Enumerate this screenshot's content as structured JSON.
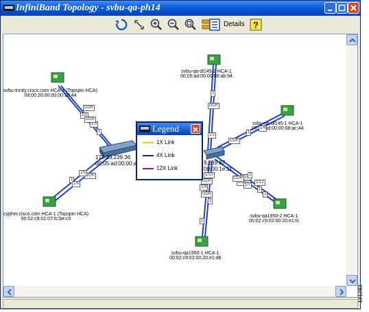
{
  "window": {
    "title": "InfiniBand Topology - svbu-qa-ph14"
  },
  "toolbar": {
    "details_label": "Details"
  },
  "nodes": {
    "dl145_2": {
      "name": "svbu-qa-dl145-2 HCA-1",
      "guid": "00:05:ad:00:00:08:ab:94"
    },
    "trinity": {
      "name": "svbu-trinity.cisco.com HCA-1 (Topspin HCA)",
      "guid": "08:00:20:00:00:00:10:44"
    },
    "dl145_1": {
      "name": "svbu-qa-dl145-1 HCA-1",
      "guid": "00:05:ad:00:00:08:ac:44"
    },
    "cypher": {
      "name": "cypher.cisco.com HCA-1 (Topspin HCA)",
      "guid": "00:02:c9:01:07:fc:be:c0"
    },
    "qa1950_2": {
      "name": "svbu-qa1950-2 HCA-1",
      "guid": "00:02:c9:02:00:20:e1:fc"
    },
    "qa1950_1": {
      "name": "svbu-qa1950-1 HCA-1",
      "guid": "00:02:c9:02:00:20:e1:d8"
    }
  },
  "switches": {
    "left": {
      "ip": "172.29.239.36",
      "guid": "00:05:ad:00:00:ab:4"
    },
    "right": {
      "ip": "9.239.67",
      "guid": "00:00:1e:11"
    }
  },
  "ports": {
    "p1": "1",
    "p2": "DDR",
    "p3": "1/1",
    "p4": "DDR",
    "p5": "1/2",
    "p6": "1/3",
    "p7": "DDR",
    "p8": "1",
    "p9": "1",
    "p10": "1/4",
    "p11": "DDR",
    "p12": "DDR",
    "p13": "1/5",
    "p14": "1",
    "p15": "1/6",
    "p16": "DDR",
    "p17": "1/10",
    "p18": "1/4",
    "p19": "DDR",
    "p20": "1",
    "p21": "DDR",
    "p22": "1/12",
    "p23": "2",
    "p24": "1",
    "p25": "DDR",
    "p26": "1/7",
    "p27": "DDR",
    "p28": "2",
    "p29": "1"
  },
  "legend": {
    "title": "Legend",
    "items": [
      {
        "label": "1X Link",
        "color": "#ffcc00"
      },
      {
        "label": "4X Link",
        "color": "#1a1aa0"
      },
      {
        "label": "12X Link",
        "color": "#8b1a8b"
      }
    ]
  },
  "side_label": "181283",
  "colors": {
    "link": "#1a3fd0",
    "title_bar": "#0a5ed7"
  }
}
